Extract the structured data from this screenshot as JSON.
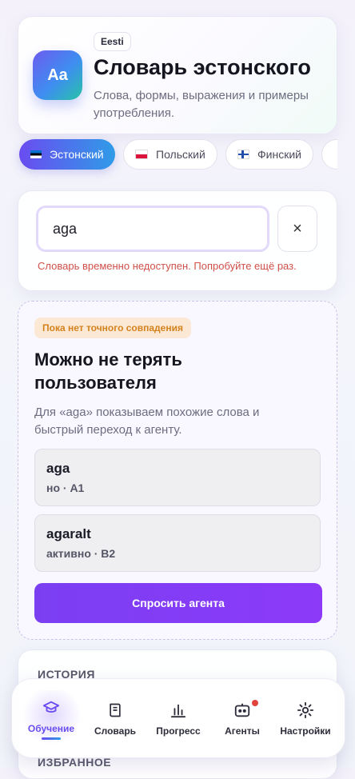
{
  "header": {
    "logo_text": "Aa",
    "language_tag": "Eesti",
    "title": "Словарь эстонского",
    "subtitle": "Слова, формы, выражения и примеры употребления."
  },
  "languages": [
    {
      "label": "Эстонский",
      "flag": "ee",
      "active": true
    },
    {
      "label": "Польский",
      "flag": "pl",
      "active": false
    },
    {
      "label": "Финский",
      "flag": "fi",
      "active": false
    }
  ],
  "search": {
    "value": "aga",
    "clear_icon": "×",
    "error": "Словарь временно недоступен. Попробуйте ещё раз."
  },
  "suggestions": {
    "badge": "Пока нет точного совпадения",
    "title": "Можно не терять пользователя",
    "description": "Для «aga» показываем похожие слова и быстрый переход к агенту.",
    "items": [
      {
        "word": "aga",
        "meta": "но · A1"
      },
      {
        "word": "agaralt",
        "meta": "активно · B2"
      }
    ],
    "ask_button": "Спросить агента"
  },
  "history": {
    "label": "ИСТОРИЯ",
    "favorites_label": "ИЗБРАННОЕ"
  },
  "nav": {
    "items": [
      {
        "label": "Обучение",
        "icon": "graduation-cap-icon",
        "active": true
      },
      {
        "label": "Словарь",
        "icon": "book-icon",
        "active": false
      },
      {
        "label": "Прогресс",
        "icon": "bar-chart-icon",
        "active": false
      },
      {
        "label": "Агенты",
        "icon": "robot-icon",
        "active": false,
        "notification": true
      },
      {
        "label": "Настройки",
        "icon": "gear-icon",
        "active": false
      }
    ]
  },
  "colors": {
    "accent": "#6a4cf0",
    "accent_secondary": "#2f9be8",
    "error": "#d0504a",
    "badge_bg": "#fbe9d6",
    "badge_text": "#d4821c",
    "ask_button": "#8c3af8"
  }
}
